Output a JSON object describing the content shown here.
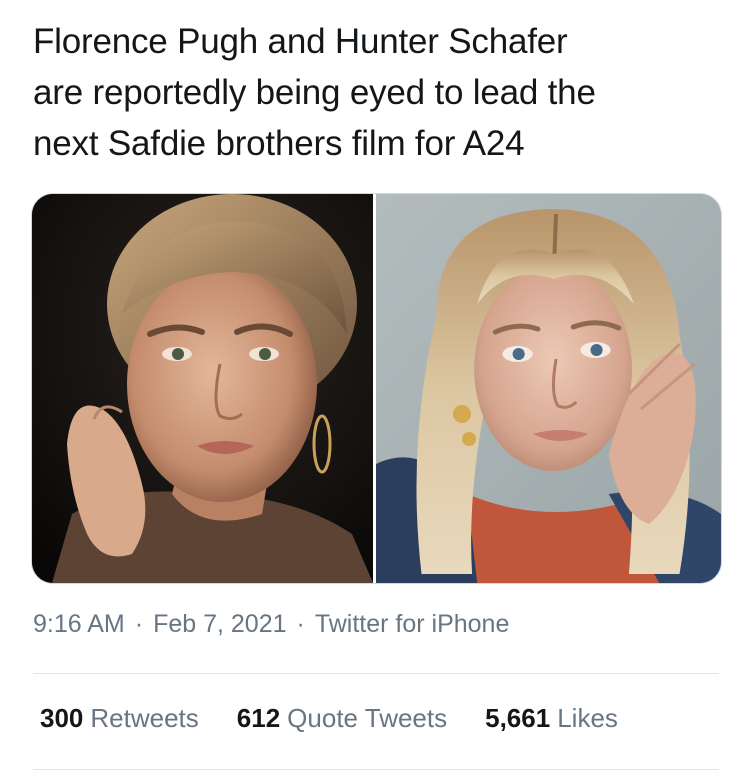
{
  "tweet": {
    "text": "Florence Pugh and Hunter Schafer\nare reportedly being eyed to lead the\nnext Safdie brothers film for A24",
    "time": "9:16 AM",
    "separator": "·",
    "date": "Feb 7, 2021",
    "source": "Twitter for iPhone"
  },
  "stats": {
    "retweets_count": "300",
    "retweets_label": "Retweets",
    "quotes_count": "612",
    "quotes_label": "Quote Tweets",
    "likes_count": "5,661",
    "likes_label": "Likes"
  },
  "media": {
    "photo_left": "portrait-photo",
    "photo_right": "portrait-photo"
  },
  "colors": {
    "text": "#14171a",
    "secondary_text": "#687684",
    "divider": "#e1e8ed",
    "media_border": "#cfd9de"
  }
}
